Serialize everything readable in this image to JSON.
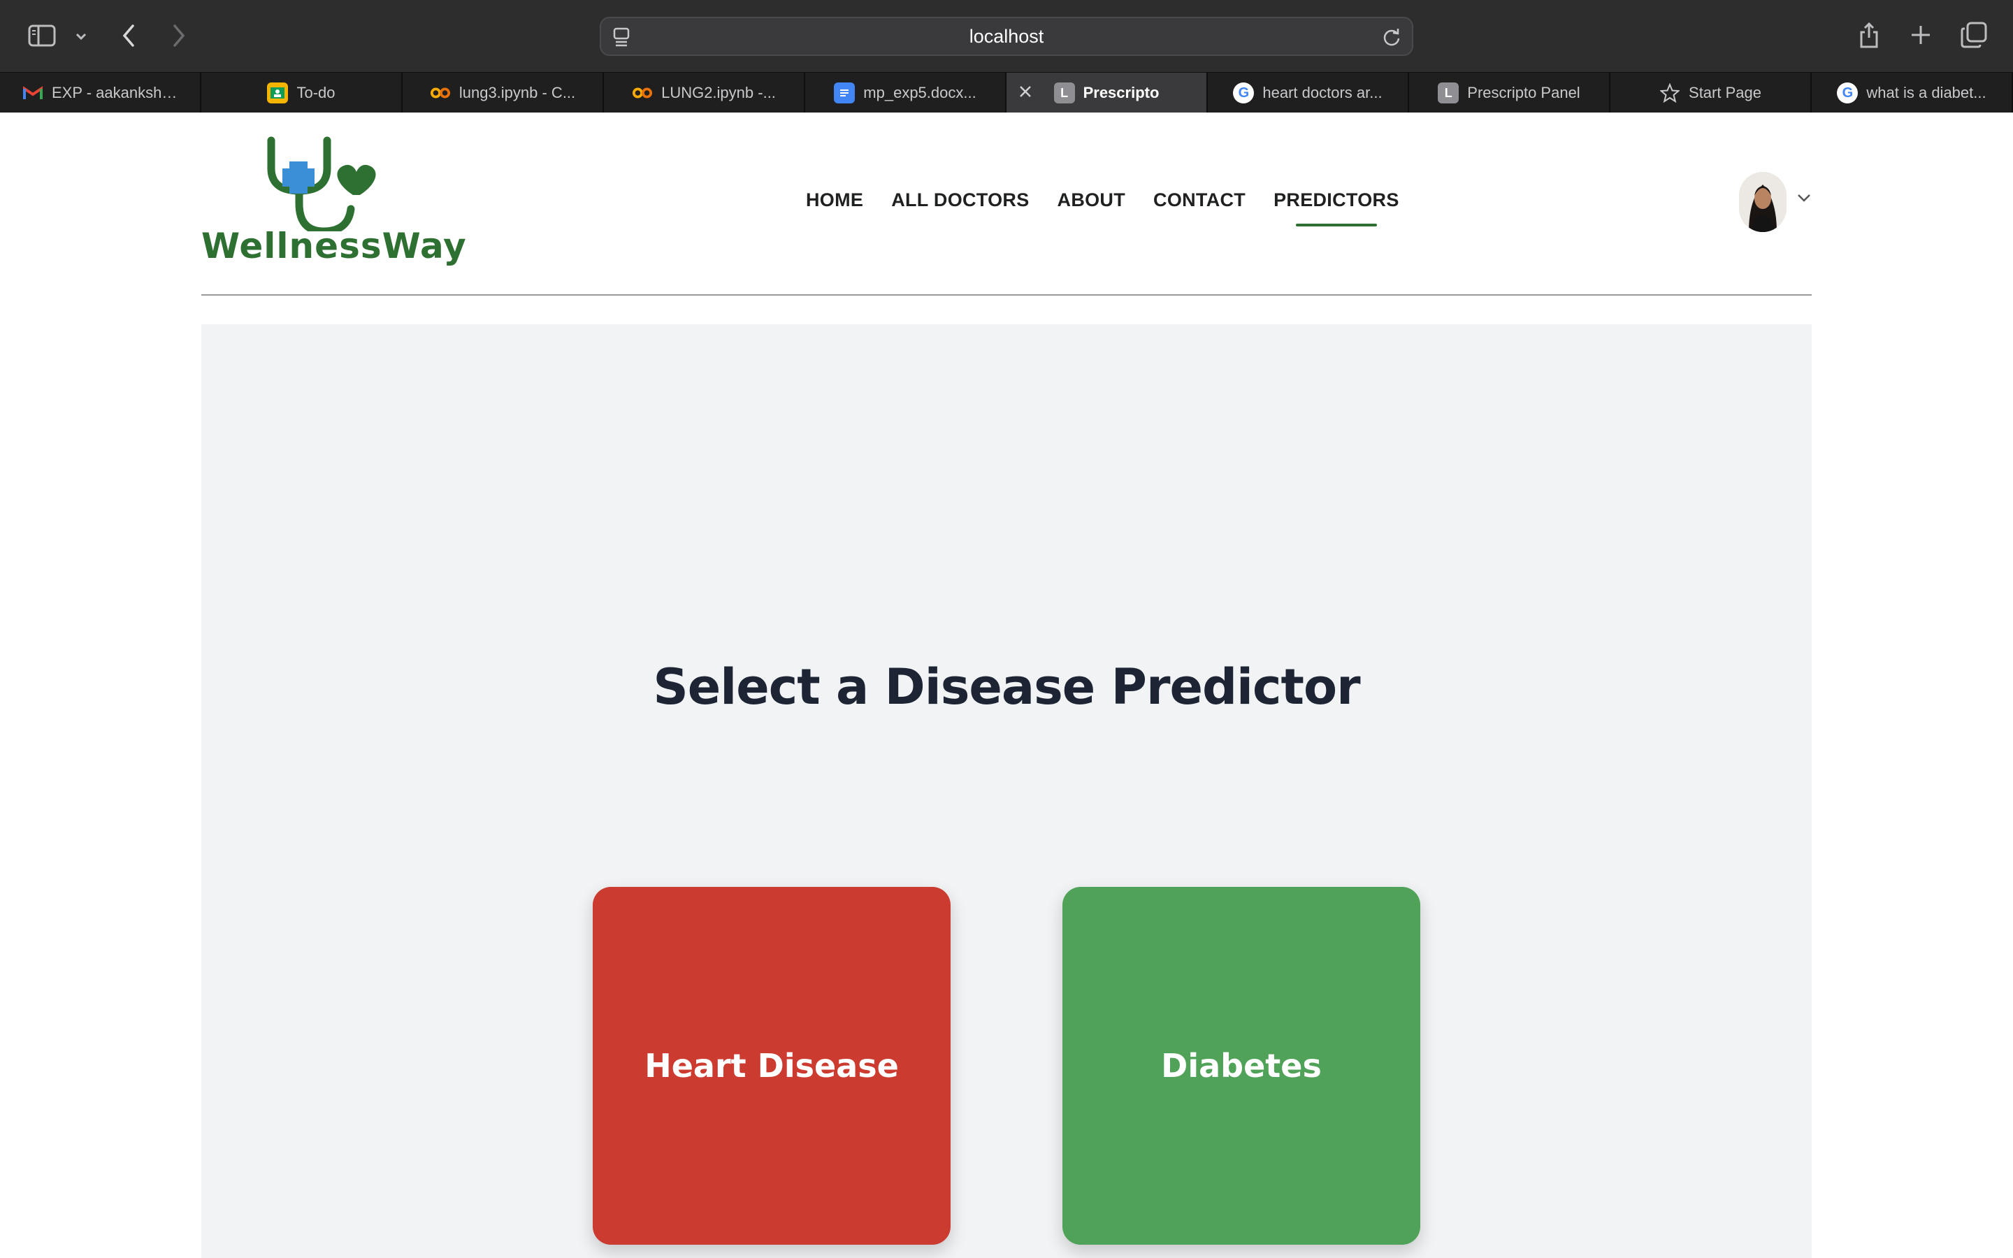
{
  "browser": {
    "url": "localhost",
    "tabs": [
      {
        "label": "EXP - aakanksh....",
        "icon": "gmail-icon"
      },
      {
        "label": "To-do",
        "icon": "classroom-icon"
      },
      {
        "label": "lung3.ipynb - C...",
        "icon": "colab-icon"
      },
      {
        "label": "LUNG2.ipynb -...",
        "icon": "colab-icon"
      },
      {
        "label": "mp_exp5.docx...",
        "icon": "docs-icon"
      },
      {
        "label": "Prescripto",
        "icon": "letter-l-icon",
        "favicon_letter": "L",
        "active": true
      },
      {
        "label": "heart doctors ar...",
        "icon": "google-icon"
      },
      {
        "label": "Prescripto Panel",
        "icon": "letter-l-icon",
        "favicon_letter": "L"
      },
      {
        "label": "Start Page",
        "icon": "star-icon"
      },
      {
        "label": "what is a diabet...",
        "icon": "google-icon"
      }
    ]
  },
  "brand": {
    "name": "WellnessWay",
    "color": "#2e7031",
    "accent": "#3a8fd6"
  },
  "nav": {
    "items": [
      {
        "label": "HOME"
      },
      {
        "label": "ALL DOCTORS"
      },
      {
        "label": "ABOUT"
      },
      {
        "label": "CONTACT"
      },
      {
        "label": "PREDICTORS",
        "active": true
      }
    ]
  },
  "main": {
    "title": "Select a Disease Predictor",
    "cards": [
      {
        "label": "Heart Disease",
        "color": "#cb3b30"
      },
      {
        "label": "Diabetes",
        "color": "#4fa257"
      }
    ]
  }
}
